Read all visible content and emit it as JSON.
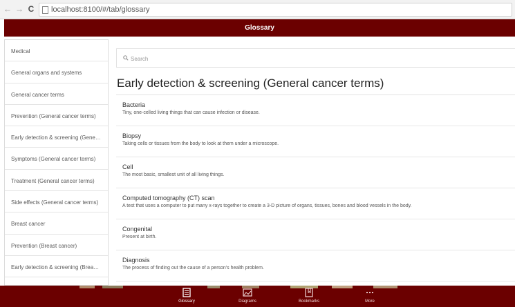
{
  "browser": {
    "url": "localhost:8100/#/tab/glossary",
    "back_icon": "back-arrow-icon",
    "forward_icon": "forward-arrow-icon",
    "reload_icon": "reload-icon"
  },
  "header": {
    "title": "Glossary",
    "color": "#6b0000"
  },
  "sidebar": {
    "items": [
      {
        "label": "Medical"
      },
      {
        "label": "General organs and systems"
      },
      {
        "label": "General cancer terms"
      },
      {
        "label": "Prevention (General cancer terms)"
      },
      {
        "label": "Early detection & screening (General cancer terms)"
      },
      {
        "label": "Symptoms (General cancer terms)"
      },
      {
        "label": "Treatment (General cancer terms)"
      },
      {
        "label": "Side effects (General cancer terms)"
      },
      {
        "label": "Breast cancer"
      },
      {
        "label": "Prevention (Breast cancer)"
      },
      {
        "label": "Early detection & screening (Breast cancer)"
      }
    ]
  },
  "main": {
    "search": {
      "placeholder": "Search",
      "value": ""
    },
    "section_title": "Early detection & screening (General cancer terms)",
    "terms": [
      {
        "name": "Bacteria",
        "definition": "Tiny, one-celled living things that can cause infection or disease."
      },
      {
        "name": "Biopsy",
        "definition": "Taking cells or tissues from the body to look at them under a microscope."
      },
      {
        "name": "Cell",
        "definition": "The most basic, smallest unit of all living things."
      },
      {
        "name": "Computed tomography (CT) scan",
        "definition": "A test that uses a computer to put many x-rays together to create a 3-D picture of organs, tissues, bones and blood vessels in the body."
      },
      {
        "name": "Congenital",
        "definition": "Present at birth."
      },
      {
        "name": "Diagnosis",
        "definition": "The process of finding out the cause of a person's health problem."
      }
    ]
  },
  "tabs": [
    {
      "label": "Glossary",
      "icon": "glossary-icon",
      "active": true
    },
    {
      "label": "Diagrams",
      "icon": "diagrams-icon",
      "active": false
    },
    {
      "label": "Bookmarks",
      "icon": "bookmarks-icon",
      "active": false
    },
    {
      "label": "More",
      "icon": "more-icon",
      "active": false
    }
  ]
}
